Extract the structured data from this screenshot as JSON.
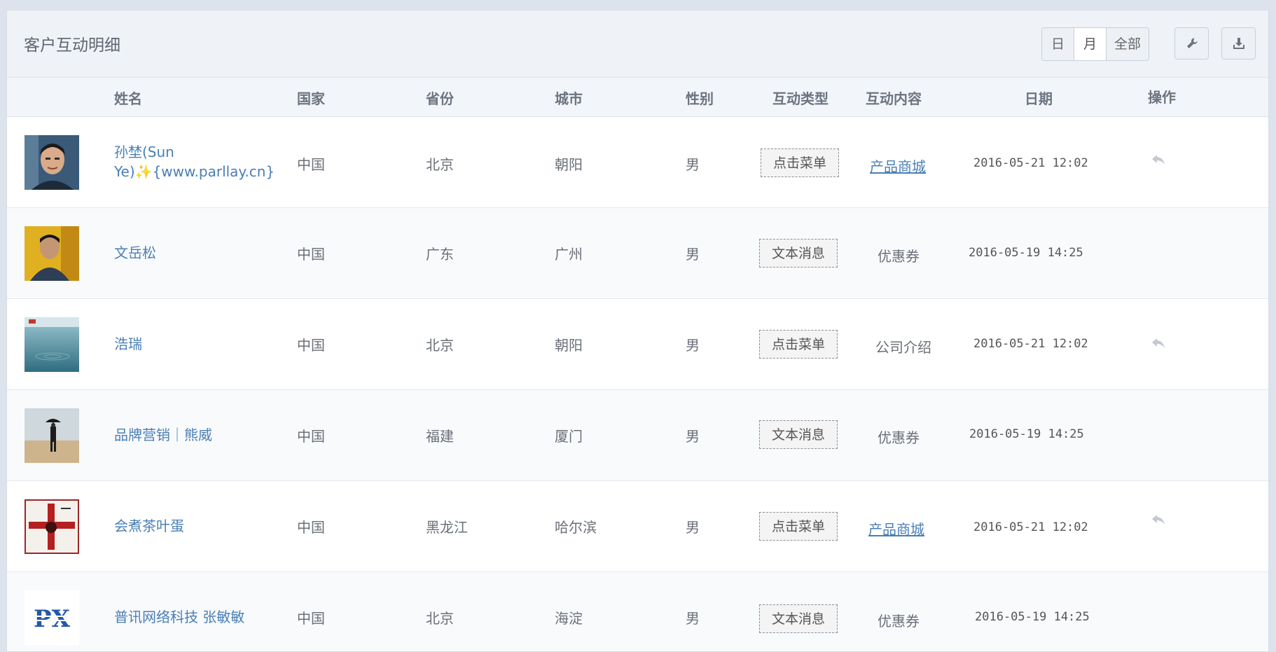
{
  "panel": {
    "title": "客户互动明细"
  },
  "toolbar": {
    "periods": [
      "日",
      "月",
      "全部"
    ],
    "active_period": "月",
    "icons": [
      "wrench-icon",
      "download-icon"
    ]
  },
  "table": {
    "headers": {
      "name": "姓名",
      "country": "国家",
      "province": "省份",
      "city": "城市",
      "gender": "性别",
      "type": "互动类型",
      "content": "互动内容",
      "date": "日期",
      "action": "操作"
    },
    "rows": [
      {
        "name": "孙埜(Sun Ye)✨{www.parllay.cn}",
        "country": "中国",
        "province": "北京",
        "city": "朝阳",
        "gender": "男",
        "type": "点击菜单",
        "content": "产品商城",
        "content_is_link": true,
        "date": "2016-05-21 12:02",
        "has_reply": true
      },
      {
        "name": "文岳松",
        "country": "中国",
        "province": "广东",
        "city": "广州",
        "gender": "男",
        "type": "文本消息",
        "content": "优惠券",
        "content_is_link": false,
        "date": "2016-05-19 14:25",
        "has_reply": false
      },
      {
        "name": "浩瑞",
        "country": "中国",
        "province": "北京",
        "city": "朝阳",
        "gender": "男",
        "type": "点击菜单",
        "content": "公司介绍",
        "content_is_link": false,
        "date": "2016-05-21 12:02",
        "has_reply": true
      },
      {
        "name": "品牌营销｜熊威",
        "country": "中国",
        "province": "福建",
        "city": "厦门",
        "gender": "男",
        "type": "文本消息",
        "content": "优惠券",
        "content_is_link": false,
        "date": "2016-05-19 14:25",
        "has_reply": false
      },
      {
        "name": "会煮茶叶蛋",
        "country": "中国",
        "province": "黑龙江",
        "city": "哈尔滨",
        "gender": "男",
        "type": "点击菜单",
        "content": "产品商城",
        "content_is_link": true,
        "date": "2016-05-21 12:02",
        "has_reply": true
      },
      {
        "name": "普讯网络科技 张敏敏",
        "country": "中国",
        "province": "北京",
        "city": "海淀",
        "gender": "男",
        "type": "文本消息",
        "content": "优惠券",
        "content_is_link": false,
        "date": "2016-05-19 14:25",
        "has_reply": false
      }
    ],
    "avatar_logo_text": "PX"
  },
  "colors": {
    "link": "#4a7fb5",
    "panel_bg": "#eff2f7",
    "page_bg": "#dde3ec"
  }
}
